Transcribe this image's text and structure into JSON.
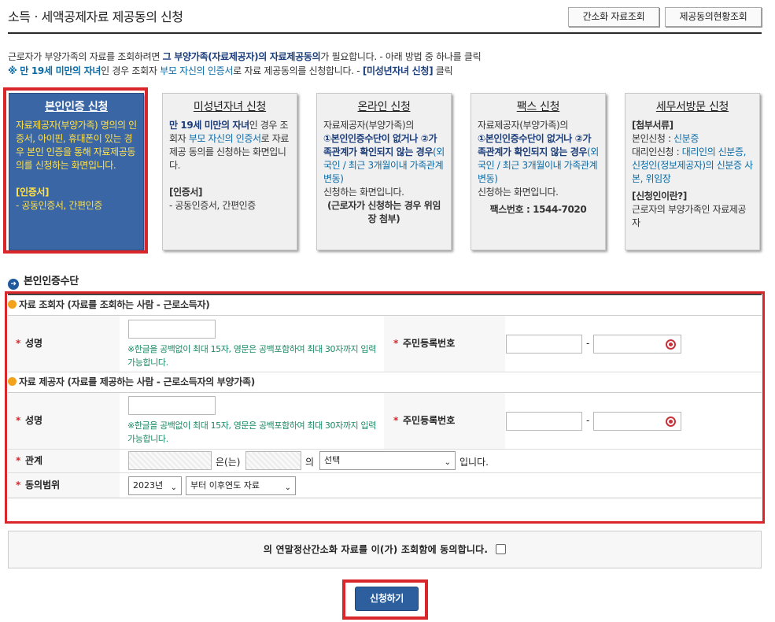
{
  "page": {
    "title": "소득ㆍ세액공제자료 제공동의 신청",
    "buttons": {
      "simple_view": "간소화 자료조회",
      "consent_status": "제공동의현황조회"
    }
  },
  "intro": {
    "line1_a": "근로자가 부양가족의 자료를 조회하려면 ",
    "line1_b": "그 부양가족(자료제공자)의 자료제공동의",
    "line1_c": "가 필요합니다. - 아래 방법 중 하나를 클릭",
    "line2_a": "※ 만 19세 미만의 자녀",
    "line2_b": "인 경우 조회자 ",
    "line2_c": "부모 자신의 인증서",
    "line2_d": "로 자료 제공동의를 신청합니다. - ",
    "line2_e": "[미성년자녀 신청]",
    "line2_f": " 클릭"
  },
  "cards": {
    "c1": {
      "title": "본인인증 신청",
      "body": "자료제공자(부양가족) 명의의 인증서, 아이핀,  휴대폰이 있는 경우 본인 인증을 통해 자료제공동의를 신청하는 화면입니다.",
      "cert_head": "[인증서]",
      "cert_body": "- 공동인증서, 간편인증"
    },
    "c2": {
      "title": "미성년자녀 신청",
      "p1": "만 19세 미만의 자녀",
      "p2": "인 경우 조회자 ",
      "p3": "부모 자신의 인증서",
      "p4": "로 자료 제공 동의를 신청하는 화면입니다.",
      "cert_head": "[인증서]",
      "cert_body": "- 공동인증서, 간편인증"
    },
    "c3": {
      "title": "온라인 신청",
      "p1": "자료제공자(부양가족)의",
      "p2": "①본인인증수단이 없거나 ②가족관계가 확인되지 않는 경우",
      "p3": "(외국인 / 최근 3개월이내 가족관계 변동)",
      "p4": "신청하는 화면입니다.",
      "p5": "(근로자가 신청하는 경우 위임장 첨부)"
    },
    "c4": {
      "title": "팩스 신청",
      "p1": "자료제공자(부양가족)의",
      "p2": "①본인인증수단이 없거나 ②가족관계가 확인되지 않는 경우",
      "p3": "(외국인 / 최근 3개월이내 가족관계 변동)",
      "p4": "신청하는 화면입니다.",
      "p5": "팩스번호 : 1544-7020"
    },
    "c5": {
      "title": "세무서방문 신청",
      "h1": "[첨부서류]",
      "p1a": "본인신청 : ",
      "p1b": "신분증",
      "p2a": "대리인신청 : ",
      "p2b": "대리인의 신분증, 신청인(정보제공자)의 신분증 사본, 위임장",
      "h2": "[신청인이란?]",
      "p3": "근로자의 부양가족인 자료제공자"
    }
  },
  "section": {
    "title": "본인인증수단"
  },
  "requester": {
    "header": "자료 조회자 (자료를 조회하는 사람 - 근로소득자)",
    "name_label": "성명",
    "note": "※한글을 공백없이 최대 15자, 영문은 공백포함하여 최대 30자까지 입력가능합니다.",
    "rrn_label": "주민등록번호",
    "dash": "-"
  },
  "provider": {
    "header": "자료 제공자 (자료를 제공하는 사람 - 근로소득자의 부양가족)",
    "name_label": "성명",
    "note": "※한글을 공백없이 최대 15자, 영문은 공백포함하여 최대 30자까지 입력가능합니다.",
    "rrn_label": "주민등록번호",
    "dash": "-",
    "relation_label": "관계",
    "relation_mid1": "은(는)",
    "relation_mid2": "의",
    "relation_select": "선택",
    "relation_end": "입니다.",
    "scope_label": "동의범위",
    "year_select": "2023년",
    "scope_select": "부터 이후연도 자료"
  },
  "agree": {
    "text": "의 연말정산간소화 자료를 이(가) 조회함에 동의합니다."
  },
  "submit": {
    "label": "신청하기"
  },
  "colors": {
    "highlight": "#d8262b",
    "accent": "#3b66a6",
    "link": "#0a6aa6"
  }
}
